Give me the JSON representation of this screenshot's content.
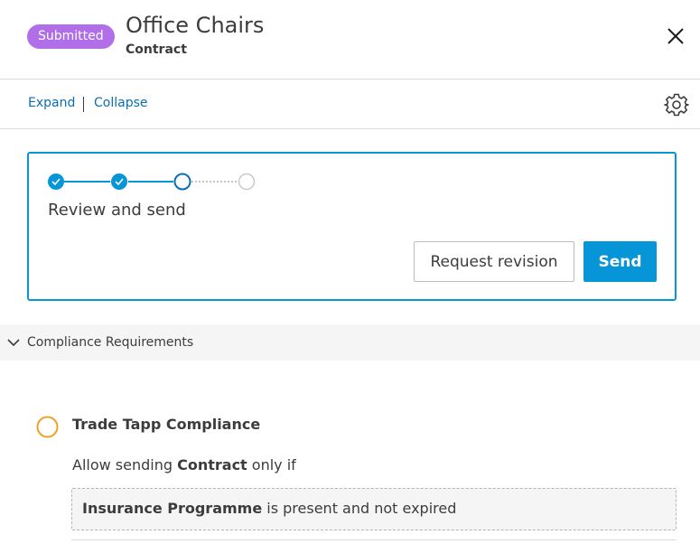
{
  "header": {
    "status_badge": "Submitted",
    "title": "Office Chairs",
    "subtitle": "Contract",
    "close_icon": "close-icon"
  },
  "toolbar": {
    "expand_label": "Expand",
    "collapse_label": "Collapse",
    "settings_icon": "gear-icon"
  },
  "workflow": {
    "steps": [
      {
        "state": "completed"
      },
      {
        "state": "completed"
      },
      {
        "state": "current"
      },
      {
        "state": "upcoming"
      }
    ],
    "current_step_title": "Review and send",
    "request_revision_label": "Request revision",
    "send_label": "Send"
  },
  "compliance": {
    "section_label": "Compliance Requirements",
    "requirement_title": "Trade Tapp Compliance",
    "rule_prefix": "Allow sending ",
    "rule_document": "Contract",
    "rule_suffix": " only if",
    "condition_document": "Insurance Programme",
    "condition_text": " is present and not expired"
  },
  "colors": {
    "accent": "#0696d7",
    "badge": "#b06ee8",
    "link": "#0a6eb4",
    "pending": "#f0a020",
    "text": "#3c3c3c"
  }
}
